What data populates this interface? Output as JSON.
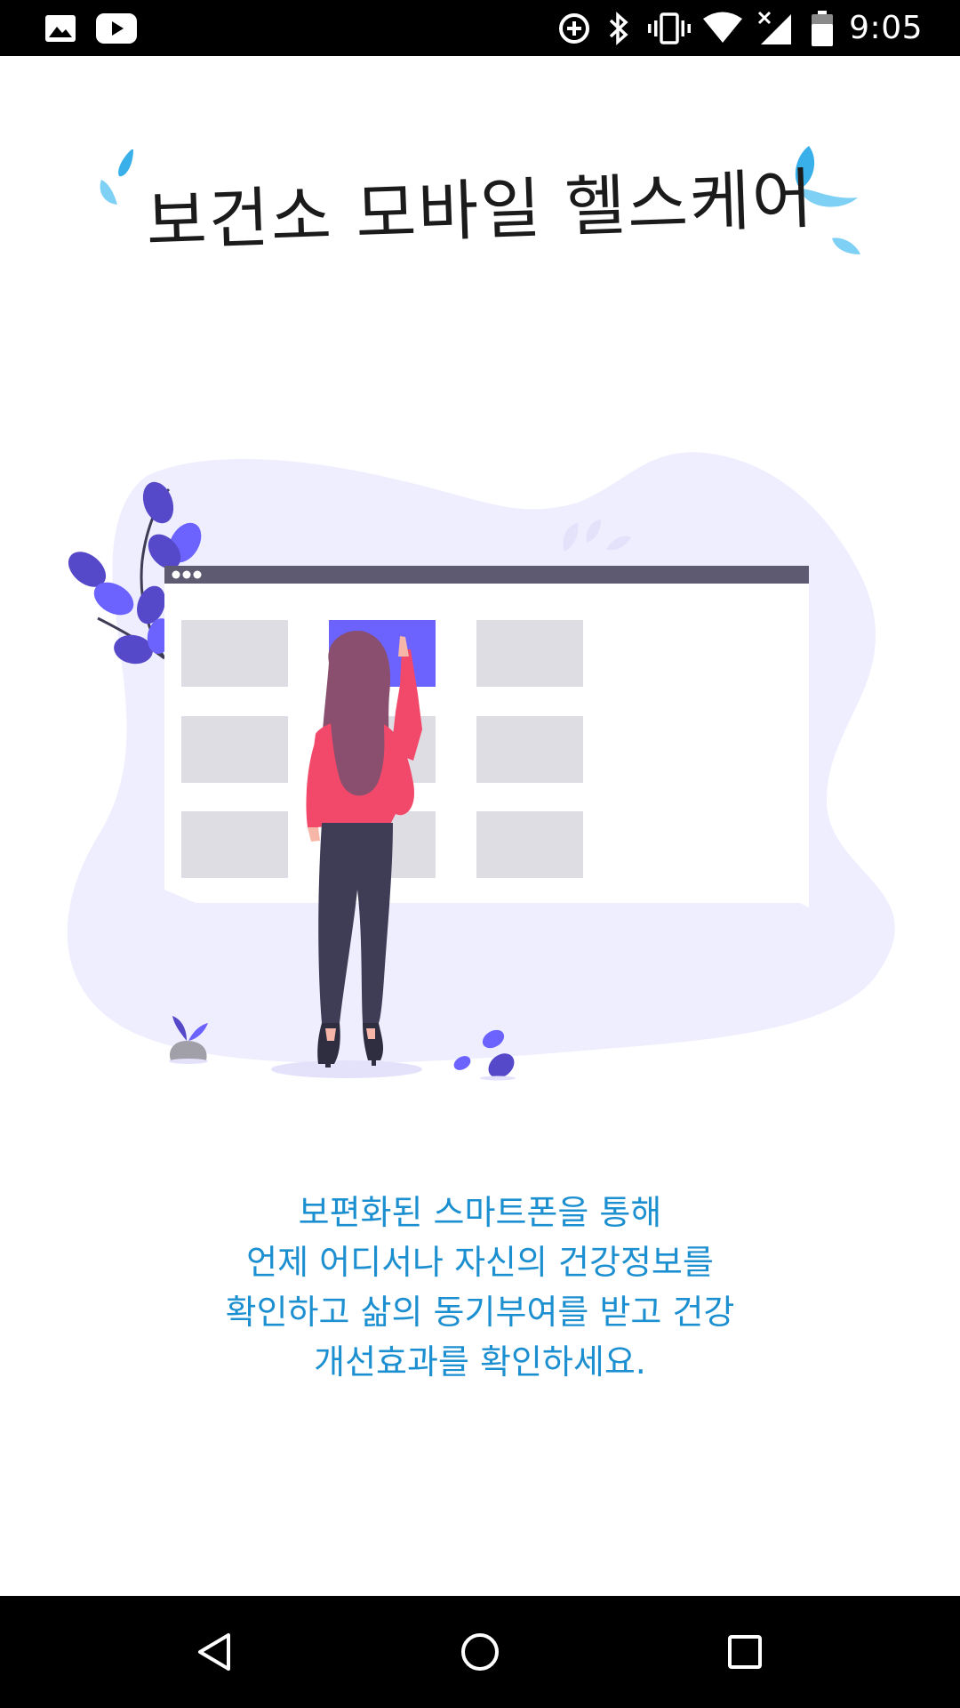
{
  "status_bar": {
    "time": "9:05",
    "left_icons": [
      "gallery-notification-icon",
      "youtube-notification-icon"
    ],
    "right_icons": [
      "data-saver-icon",
      "bluetooth-icon",
      "vibrate-icon",
      "wifi-icon",
      "cellular-signal-icon",
      "battery-icon"
    ]
  },
  "header": {
    "title": "보건소 모바일 헬스케어"
  },
  "description": {
    "lines": [
      "보편화된 스마트폰을 통해",
      "언제 어디서나 자신의 건강정보를",
      "확인하고 삶의 동기부여를 받고 건강",
      "개선효과를 확인하세요."
    ]
  },
  "navigation": {
    "buttons": [
      "back-icon",
      "home-icon",
      "recents-icon"
    ]
  },
  "colors": {
    "accent_text": "#1b8fd0",
    "drop_blue": "#3ab0ea",
    "blob": "#efeeff",
    "highlight_tile": "#6c63ff",
    "jacket": "#f2496a",
    "leaf": "#5549c9"
  }
}
